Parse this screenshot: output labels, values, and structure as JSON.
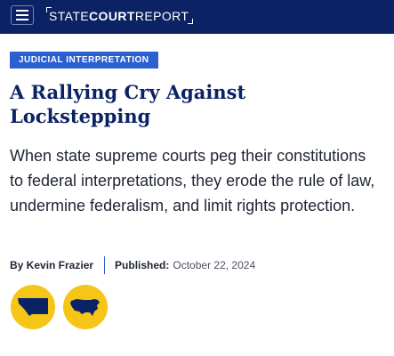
{
  "header": {
    "logo_part1": "STATE",
    "logo_part2": "COURT",
    "logo_part3": "REPORT",
    "menu_icon": "hamburger-menu-icon",
    "bg_color": "#0b2265"
  },
  "article": {
    "category": "JUDICIAL INTERPRETATION",
    "title": "A Rallying Cry Against Lockstepping",
    "dek": "When state supreme courts peg their constitutions to federal interpretations, they erode the rule of law, undermine federalism, and limit rights protection.",
    "byline": "By Kevin Frazier",
    "published_label": "Published:",
    "published_date": "October 22, 2024",
    "accent_color": "#2c5fd0",
    "title_color": "#0b2265"
  },
  "tags": [
    {
      "icon": "montana-map-icon"
    },
    {
      "icon": "usa-map-icon"
    }
  ],
  "tag_circle_color": "#f5c518"
}
